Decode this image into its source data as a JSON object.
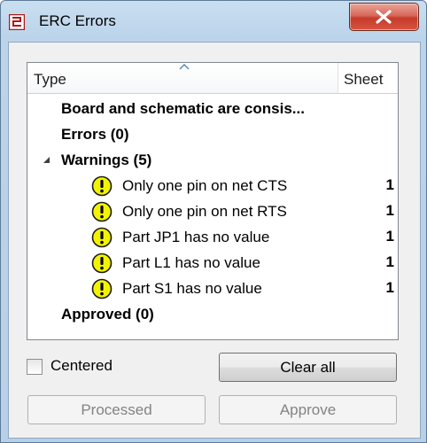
{
  "window": {
    "title": "ERC Errors"
  },
  "list": {
    "columns": {
      "type": "Type",
      "sheet": "Sheet"
    },
    "rows": [
      {
        "label": "Board and schematic are consis..."
      },
      {
        "label": "Errors (0)"
      },
      {
        "label": "Warnings (5)"
      },
      {
        "label": "Only one pin on net CTS",
        "sheet": "1"
      },
      {
        "label": "Only one pin on net RTS",
        "sheet": "1"
      },
      {
        "label": "Part JP1 has no value",
        "sheet": "1"
      },
      {
        "label": "Part L1 has no value",
        "sheet": "1"
      },
      {
        "label": "Part S1 has no value",
        "sheet": "1"
      },
      {
        "label": "Approved (0)"
      }
    ]
  },
  "options": {
    "centered_label": "Centered",
    "centered_checked": false
  },
  "buttons": {
    "clear_all": "Clear all",
    "processed": "Processed",
    "approve": "Approve"
  },
  "colors": {
    "warning_icon": "#f3f300",
    "close_button": "#c63b2b"
  }
}
